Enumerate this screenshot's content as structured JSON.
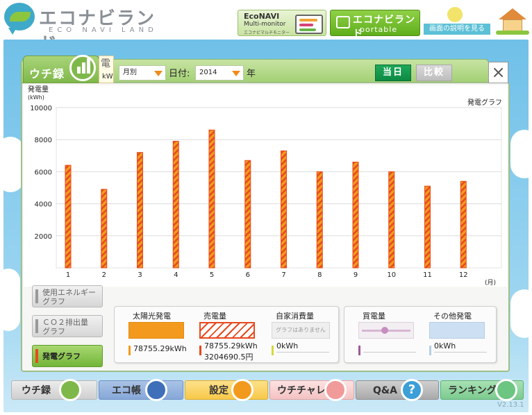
{
  "header": {
    "logo_title": "エコナビランド",
    "logo_sub": "ECO NAVI LAND",
    "econavi_line1": "EcoNAVI",
    "econavi_line2": "Multi-monitor",
    "econavi_line3": "エコナビマルチモニター",
    "portable_line1": "エコナビランド",
    "portable_line2": "portable",
    "help_label": "画面の説明を見る"
  },
  "toolbar": {
    "tab_label": "ウチ録",
    "peek_tab_char": "電",
    "peek_tab_unit": "kW",
    "period_value": "月別",
    "date_label": "日付:",
    "year_value": "2014",
    "year_label": "年",
    "today_label": "当日",
    "compare_label": "比較",
    "close_label": "×"
  },
  "chart_labels": {
    "ylabel_line1": "発電量",
    "ylabel_line2": "(kWh)",
    "chart_title": "発電グラフ",
    "x_unit": "(月)"
  },
  "chart_data": {
    "type": "bar",
    "title": "発電グラフ",
    "xlabel": "(月)",
    "ylabel": "発電量 (kWh)",
    "ylim": [
      0,
      10000
    ],
    "yticks": [
      2000,
      4000,
      6000,
      8000,
      10000
    ],
    "categories": [
      "1",
      "2",
      "3",
      "4",
      "5",
      "6",
      "7",
      "8",
      "9",
      "10",
      "11",
      "12"
    ],
    "values": [
      6400,
      4900,
      7200,
      7900,
      8600,
      6700,
      7300,
      6000,
      6600,
      6000,
      5100,
      5400
    ],
    "grid": true,
    "bar_color": "#f39a1e",
    "bar_stripe_color": "#e8491d"
  },
  "side_buttons": [
    {
      "line1": "使用エネルギー",
      "line2": "グラフ"
    },
    {
      "line1": "ＣＯ２排出量",
      "line2": "グラフ"
    },
    {
      "line1": "発電グラフ",
      "line2": ""
    }
  ],
  "legend": {
    "solar_title": "太陽光発電",
    "solar_value": "78755.29kWh",
    "sell_title": "売電量",
    "sell_value": "78755.29kWh",
    "sell_yen": "3204690.5円",
    "self_title": "自家消費量",
    "self_note": "グラフはありません",
    "self_value": "0kWh",
    "buy_title": "買電量",
    "buy_value": "",
    "other_title": "その他発電",
    "other_value": "0kWh"
  },
  "nav": {
    "uchiroku": "ウチ録",
    "ecocho": "エコ帳",
    "settei": "設定",
    "uchichare": "ウチチャレ",
    "qa": "Q&A",
    "ranking": "ランキング"
  },
  "version": "V2.13.1",
  "colors": {
    "accent_green": "#7fb84a",
    "today_green": "#0c8a43",
    "solar_orange": "#f39a1e",
    "stripe_red": "#e8491d",
    "sky_blue": "#6fc0e8"
  }
}
